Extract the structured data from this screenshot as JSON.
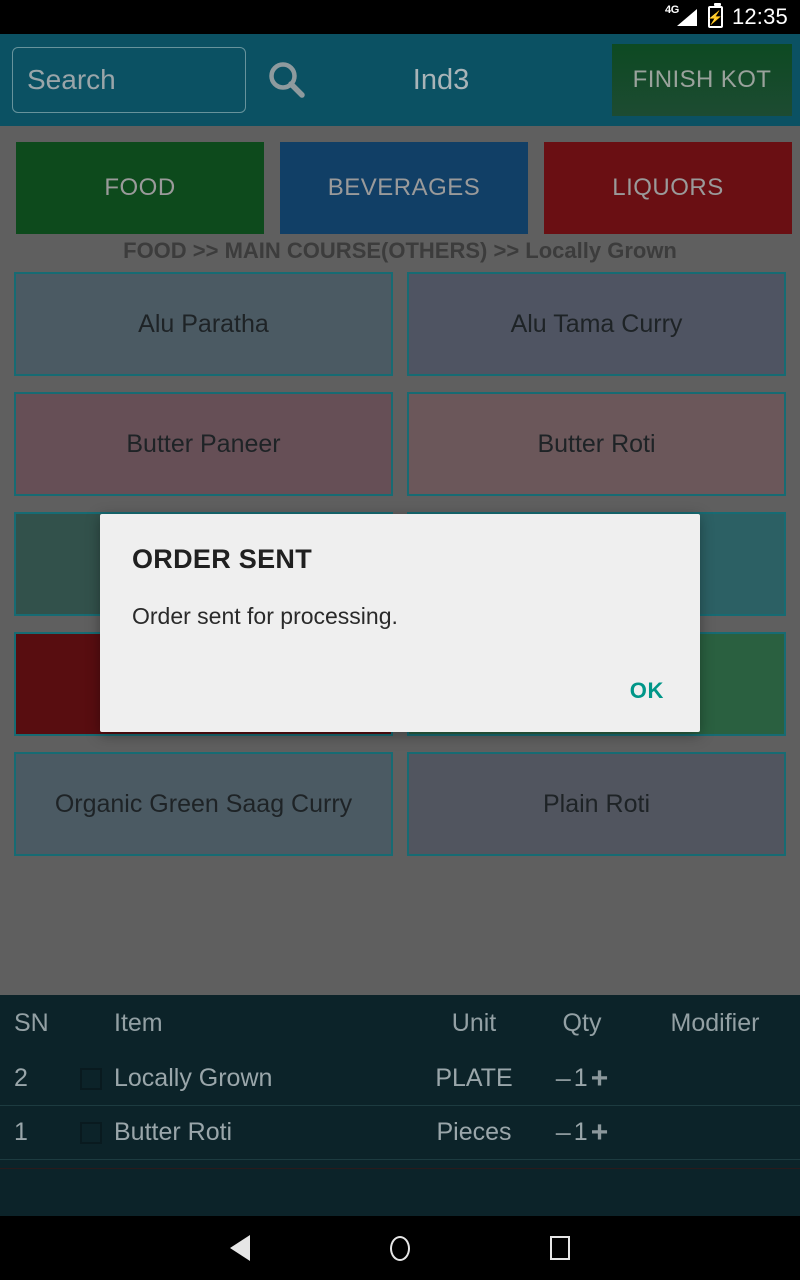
{
  "status_bar": {
    "network": "4G",
    "signal_icon": "signal-bars-icon",
    "battery_icon": "battery-charging-icon",
    "time": "12:35"
  },
  "app_bar": {
    "search_placeholder": "Search",
    "search_value": "",
    "search_icon": "search-icon",
    "table_name": "Ind3",
    "finish_kot_label": "FINISH KOT"
  },
  "categories": [
    {
      "label": "FOOD",
      "color": "#0d4a1c",
      "partial": false
    },
    {
      "label": "BEVERAGES",
      "color": "#113f66",
      "partial": false
    },
    {
      "label": "LIQUORS",
      "color": "#6a0f13",
      "partial": false
    },
    {
      "label": "",
      "color": "#1c2a55",
      "partial": true
    }
  ],
  "breadcrumb": "FOOD >> MAIN COURSE(OTHERS) >> Locally Grown",
  "items": [
    {
      "label": "Alu Paratha",
      "color": "#4b5a63"
    },
    {
      "label": "Alu Tama Curry",
      "color": "#4f5462"
    },
    {
      "label": "Butter Paneer",
      "color": "#664f56"
    },
    {
      "label": "Butter Roti",
      "color": "#6b575a"
    },
    {
      "label": "",
      "color": "#32514b"
    },
    {
      "label": "",
      "color": "#2c6064"
    },
    {
      "label": "",
      "color": "#580d10"
    },
    {
      "label": "",
      "color": "#2a6040"
    },
    {
      "label": "Organic Green Saag Curry",
      "color": "#4b5a63"
    },
    {
      "label": "Plain Roti",
      "color": "#51555f"
    }
  ],
  "order_table": {
    "columns": [
      "SN",
      "Item",
      "Unit",
      "Qty",
      "Modifier"
    ],
    "rows": [
      {
        "sn": "2",
        "item": "Locally Grown",
        "unit": "PLATE",
        "minus": "–",
        "qty": "1",
        "plus": "+",
        "modifier": ""
      },
      {
        "sn": "1",
        "item": "Butter Roti",
        "unit": "Pieces",
        "minus": "–",
        "qty": "1",
        "plus": "+",
        "modifier": ""
      }
    ]
  },
  "dialog": {
    "title": "ORDER SENT",
    "message": "Order sent for processing.",
    "ok_label": "OK",
    "accent_color": "#009688"
  },
  "nav_bar": {
    "back_icon": "back-triangle-icon",
    "home_icon": "home-circle-icon",
    "recents_icon": "recents-square-icon"
  }
}
